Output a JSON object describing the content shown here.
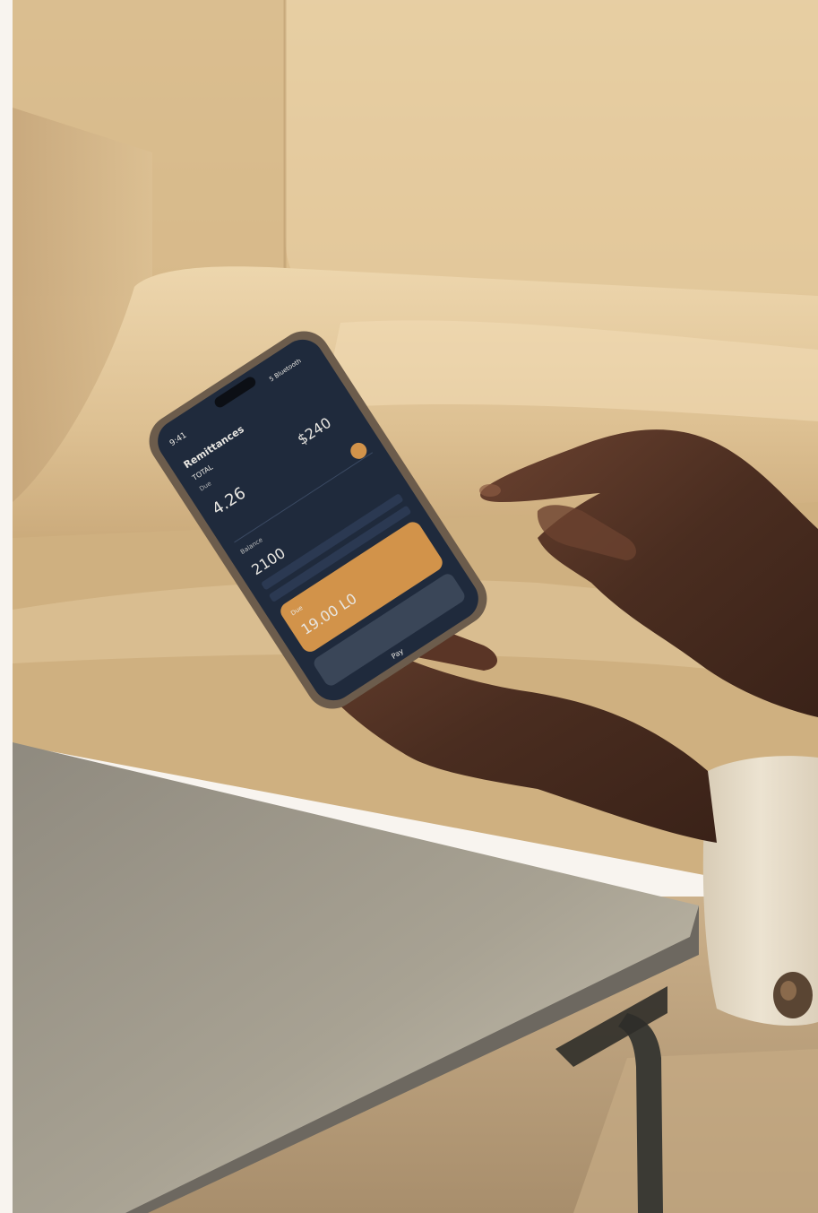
{
  "photo": {
    "palette": {
      "backdrop": "#f8f4ef",
      "sofa_light": "#ead2a8",
      "sofa_mid": "#d8b888",
      "sofa_shadow": "#b8976a",
      "table_top": "#a49e91",
      "table_edge": "#6d6860",
      "table_leg": "#3b3a34",
      "skin": "#4a2d20",
      "skin_light": "#7a4d36",
      "sleeve": "#e7dcc8",
      "button": "#5a4533",
      "phone_frame": "#6c5c4c",
      "phone_screen": "#1f2a3c",
      "accent_orange": "#d2934a"
    },
    "phone_screen": {
      "time": "9:41",
      "status": "5 Bluetooth",
      "title": "Remittances",
      "subtitle": "TOTAL",
      "label_small": "Due",
      "amount_left": "4.26",
      "amount_right": "$240",
      "row_label": "Balance",
      "row_amount": "2100",
      "card_amount": "19.00 L0",
      "card_small": "Due",
      "nav_label": "Pay"
    }
  }
}
